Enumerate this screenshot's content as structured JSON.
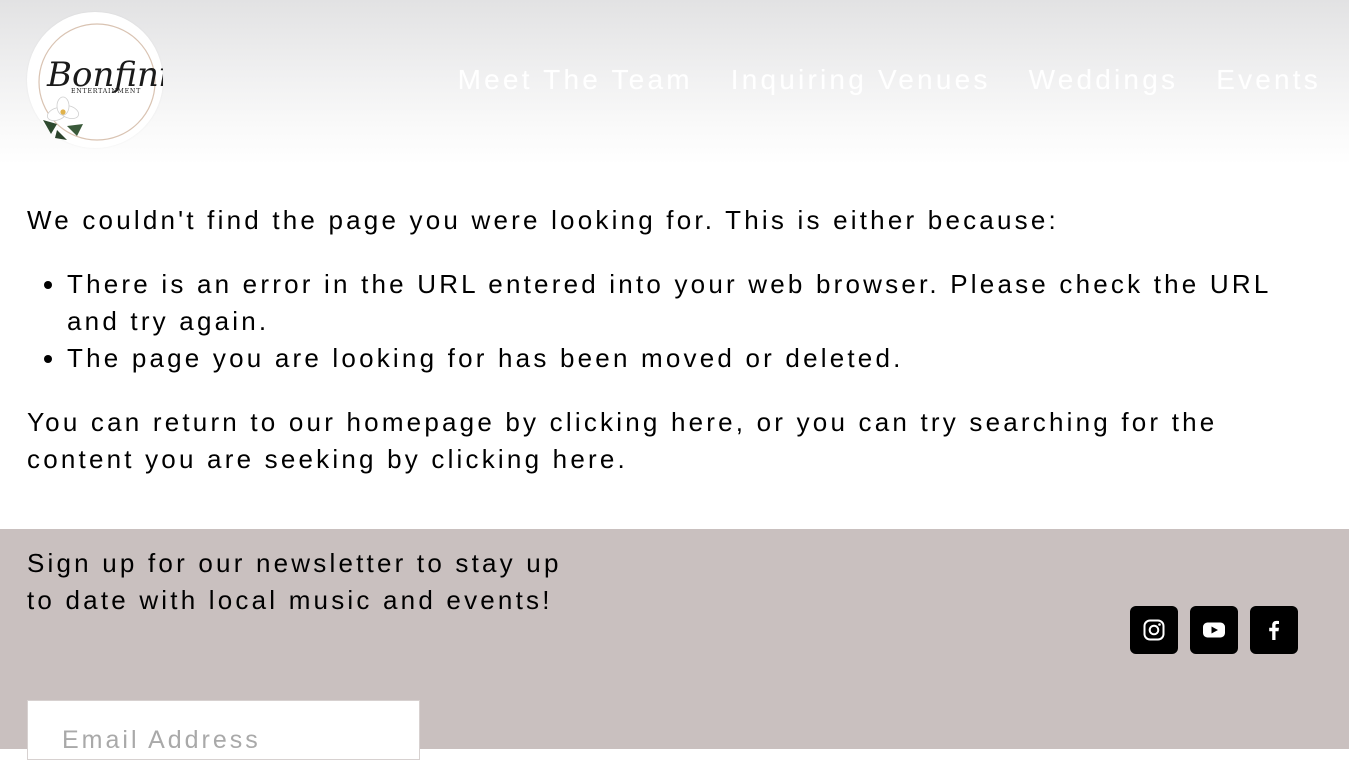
{
  "header": {
    "logo": {
      "script_text": "Bonfini",
      "sub_text": "ENTERTAINMENT"
    },
    "nav": [
      {
        "label": "Meet The Team"
      },
      {
        "label": "Inquiring Venues"
      },
      {
        "label": "Weddings"
      },
      {
        "label": "Events"
      }
    ]
  },
  "main": {
    "intro": "We couldn't find the page you were looking for. This is either because:",
    "reasons": [
      "There is an error in the URL entered into your web browser. Please check the URL and try again.",
      "The page you are looking for has been moved or deleted."
    ],
    "return_text": {
      "part1": "You can return to our homepage by clicking ",
      "link1": "here",
      "part2": ", or you can try searching for the content you are seeking by clicking ",
      "link2": "here",
      "part3": "."
    }
  },
  "footer": {
    "newsletter_text": "Sign up for our newsletter to stay up to date with local music and events!",
    "email_placeholder": "Email Address",
    "social": [
      {
        "icon": "instagram-icon"
      },
      {
        "icon": "youtube-icon"
      },
      {
        "icon": "facebook-icon"
      }
    ]
  },
  "colors": {
    "footer_bg": "#c9c0bf",
    "header_top": "#e2e2e3",
    "nav_text": "#ffffff",
    "social_bg": "#000000"
  }
}
